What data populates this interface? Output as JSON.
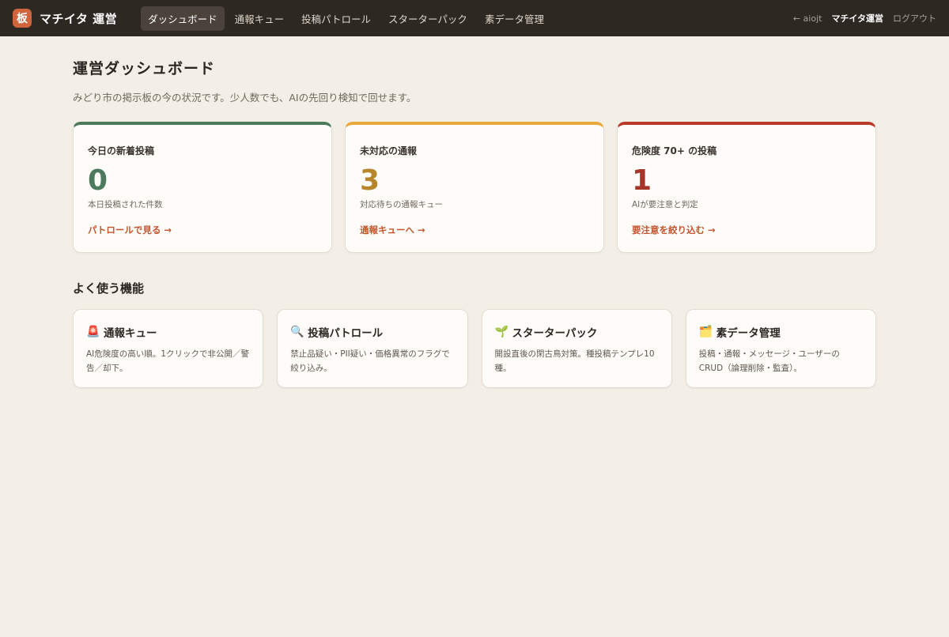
{
  "header": {
    "logo_char": "板",
    "brand": "マチイタ 運営",
    "nav": [
      {
        "label": "ダッシュボード"
      },
      {
        "label": "通報キュー"
      },
      {
        "label": "投稿パトロール"
      },
      {
        "label": "スターターパック"
      },
      {
        "label": "素データ管理"
      }
    ],
    "back_link": "← aiojt",
    "user": "マチイタ運営",
    "logout": "ログアウト"
  },
  "page": {
    "title": "運営ダッシュボード",
    "subtitle": "みどり市の掲示板の今の状況です。少人数でも、AIの先回り検知で回せます。"
  },
  "stats": [
    {
      "label": "今日の新着投稿",
      "value": "0",
      "desc": "本日投稿された件数",
      "link": "パトロールで見る →",
      "accent": "#4d7a5c"
    },
    {
      "label": "未対応の通報",
      "value": "3",
      "desc": "対応待ちの通報キュー",
      "link": "通報キューへ →",
      "accent": "#e8a83c"
    },
    {
      "label": "危険度 70+ の投稿",
      "value": "1",
      "desc": "AIが要注意と判定",
      "link": "要注意を絞り込む →",
      "accent": "#b93a2a"
    }
  ],
  "features_section": {
    "title": "よく使う機能",
    "items": [
      {
        "icon": "🚨",
        "title": "通報キュー",
        "desc": "AI危険度の高い順。1クリックで非公開／警告／却下。"
      },
      {
        "icon": "🔍",
        "title": "投稿パトロール",
        "desc": "禁止品疑い・PII疑い・価格異常のフラグで絞り込み。"
      },
      {
        "icon": "🌱",
        "title": "スターターパック",
        "desc": "開設直後の閑古鳥対策。種投稿テンプレ10種。"
      },
      {
        "icon": "🗂️",
        "title": "素データ管理",
        "desc": "投稿・通報・メッセージ・ユーザーのCRUD（論理削除・監査）。"
      }
    ]
  }
}
